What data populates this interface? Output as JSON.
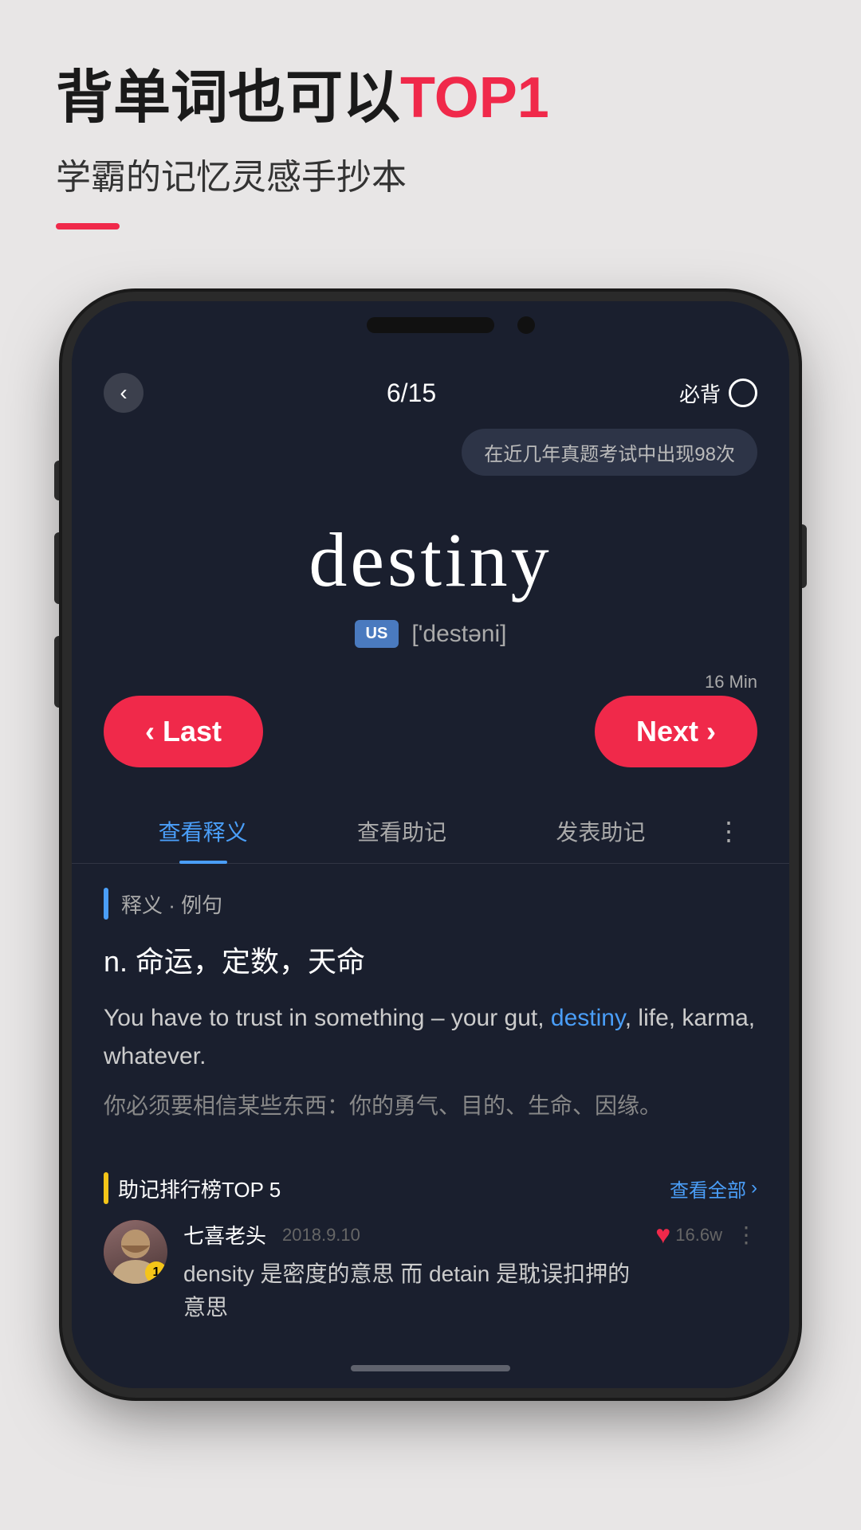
{
  "banner": {
    "title_part1": "背单词也可以",
    "title_highlight": "TOP1",
    "subtitle": "学霸的记忆灵感手抄本"
  },
  "phone": {
    "header": {
      "back_label": "‹",
      "progress": "6/15",
      "must_memorize": "必背"
    },
    "tooltip": "在近几年真题考试中出现98次",
    "word": "destiny",
    "lang_badge": "US",
    "phonetic": "['destəni]",
    "timer": "16 Min",
    "nav": {
      "last_label": "‹ Last",
      "next_label": "Next ›"
    },
    "tabs": [
      {
        "label": "查看释义",
        "active": true
      },
      {
        "label": "查看助记",
        "active": false
      },
      {
        "label": "发表助记",
        "active": false
      }
    ],
    "section_label": "释义 · 例句",
    "definition": "n.  命运，定数，天命",
    "example_en_parts": [
      {
        "text": "You have to trust in something –\nyour gut, ",
        "highlight": false
      },
      {
        "text": "destiny",
        "highlight": true
      },
      {
        "text": ", life, karma, whatever.",
        "highlight": false
      }
    ],
    "example_zh": "你必须要相信某些东西：你的勇气、目的、生命、因缘。",
    "mnemonic_section": {
      "title": "助记排行榜TOP 5",
      "view_all": "查看全部",
      "user": {
        "name": "七喜老头",
        "date": "2018.9.10",
        "rank": "1",
        "content": "density 是密度的意思 而 detain 是耽误扣押的意思",
        "likes": "16.6w"
      }
    }
  }
}
